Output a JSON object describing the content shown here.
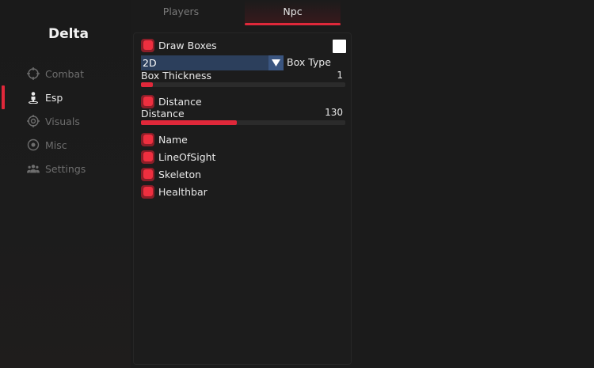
{
  "brand": "Delta",
  "sidebar": {
    "items": [
      {
        "label": "Combat",
        "icon": "crosshair-icon",
        "active": false
      },
      {
        "label": "Esp",
        "icon": "person-icon",
        "active": true
      },
      {
        "label": "Visuals",
        "icon": "target-icon",
        "active": false
      },
      {
        "label": "Misc",
        "icon": "circle-dot-icon",
        "active": false
      },
      {
        "label": "Settings",
        "icon": "users-icon",
        "active": false
      }
    ]
  },
  "tabs": [
    {
      "label": "Players",
      "active": false
    },
    {
      "label": "Npc",
      "active": true
    }
  ],
  "panel": {
    "draw_boxes": {
      "label": "Draw Boxes",
      "checked": true,
      "color": "#ffffff"
    },
    "box_type": {
      "value": "2D",
      "label": "Box Type"
    },
    "box_thickness": {
      "label": "Box Thickness",
      "value": "1",
      "fraction": 0.06
    },
    "distance_toggle": {
      "label": "Distance",
      "checked": true
    },
    "distance_slider": {
      "label": "Distance",
      "value": "130",
      "fraction": 0.47
    },
    "name": {
      "label": "Name",
      "checked": true
    },
    "line_of_sight": {
      "label": "LineOfSight",
      "checked": true
    },
    "skeleton": {
      "label": "Skeleton",
      "checked": true
    },
    "healthbar": {
      "label": "Healthbar",
      "checked": true
    }
  },
  "colors": {
    "accent": "#e0283a",
    "checkbox_fill": "#ee2f3f",
    "combo_bg": "#2c3f5c"
  }
}
